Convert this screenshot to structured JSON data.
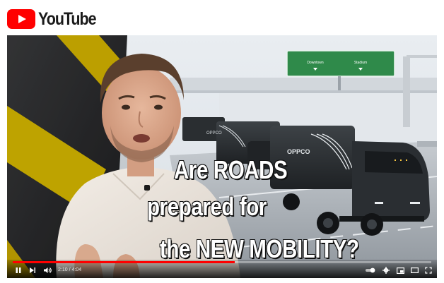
{
  "header": {
    "logo_icon": "youtube-play-logo-icon",
    "logo_text": "YouTube",
    "brand_color": "#ff0000"
  },
  "video": {
    "title_lines": [
      "Are ROADS",
      "prepared for",
      "the NEW MOBILITY?"
    ],
    "sign_left": "Downtown",
    "sign_right": "Stadium",
    "truck_logo": "OPPCO"
  },
  "controls": {
    "time_display": "2:10 / 4:04",
    "progress_fraction": 0.53,
    "progress_color": "#ff0000",
    "icons": [
      "pause-icon",
      "next-icon",
      "volume-icon",
      "autoplay-toggle-icon",
      "settings-gear-icon",
      "miniplayer-icon",
      "theater-mode-icon",
      "fullscreen-icon"
    ]
  }
}
